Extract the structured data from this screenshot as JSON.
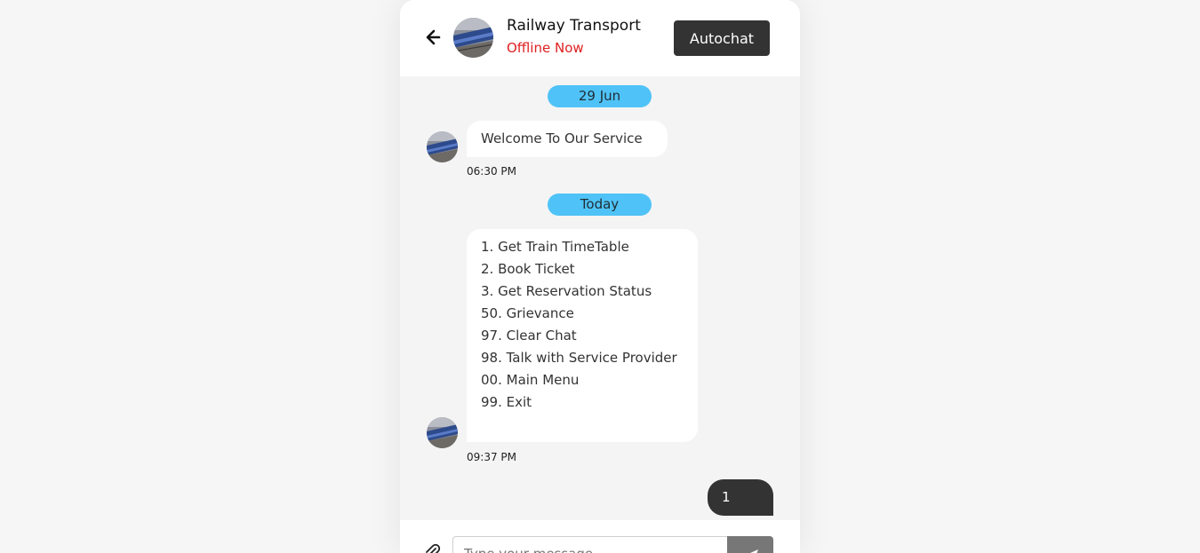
{
  "header": {
    "contact_name": "Railway Transport",
    "contact_status": "Offline Now",
    "autochat_label": "Autochat",
    "back_icon": "arrow-left-icon",
    "avatar_icon": "train-photo-avatar"
  },
  "messages": {
    "date1": "29 Jun",
    "welcome_text": "Welcome To Our Service",
    "welcome_time": "06:30 PM",
    "date2": "Today",
    "menu_items": [
      "1. Get Train TimeTable",
      "2. Book Ticket",
      "3. Get Reservation Status",
      "50. Grievance",
      "97. Clear Chat",
      "98. Talk with Service Provider",
      "00. Main Menu",
      "99. Exit"
    ],
    "menu_time": "09:37 PM",
    "user_reply": "1"
  },
  "composer": {
    "placeholder": "Type your message",
    "attach_icon": "paperclip-icon",
    "send_icon": "send-icon"
  },
  "colors": {
    "accent_date_chip": "#4fc3f7",
    "dark_button": "#333333",
    "status_offline": "#e02020",
    "send_button": "#777777"
  }
}
